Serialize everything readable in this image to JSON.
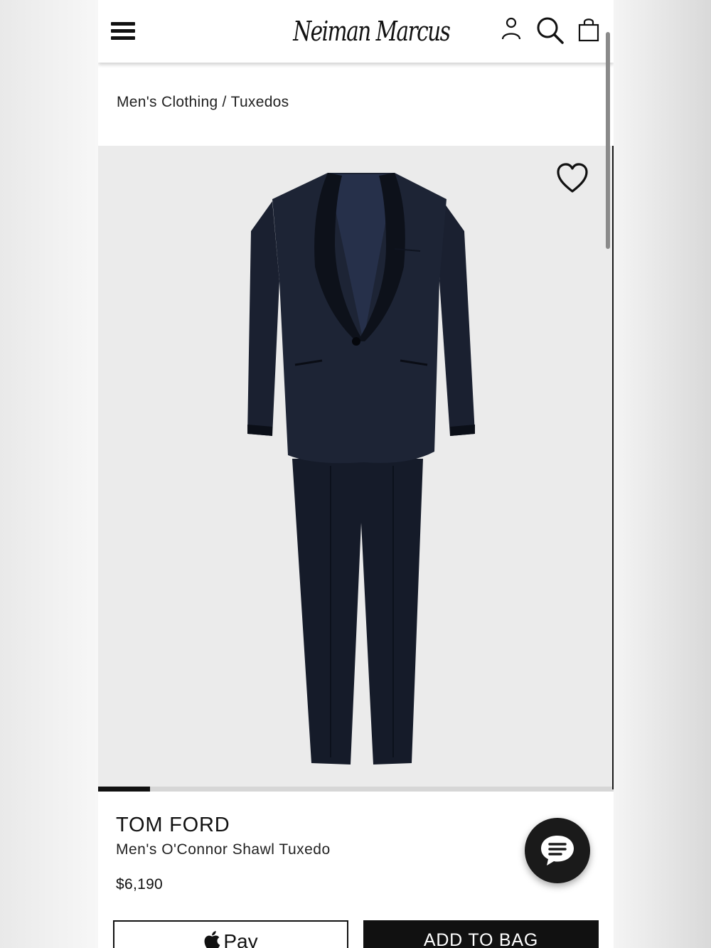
{
  "header": {
    "brand": "Neiman Marcus",
    "icons": [
      "menu-icon",
      "account-icon",
      "search-icon",
      "shopping-bag-icon"
    ]
  },
  "breadcrumb": {
    "items": [
      "Men's Clothing",
      "Tuxedos"
    ],
    "separator": "/"
  },
  "gallery": {
    "icons": [
      "heart-icon"
    ],
    "progress_fraction": 0.1
  },
  "product": {
    "designer": "TOM FORD",
    "name": "Men's O'Connor Shawl Tuxedo",
    "price": "$6,190"
  },
  "chat": {
    "icon": "chat-icon"
  },
  "actions": {
    "apple_pay_label": "Pay",
    "add_to_bag_label": "ADD TO BAG"
  },
  "colors": {
    "accent": "#111111",
    "image_background": "#ebebeb",
    "suit_navy": "#1a2030"
  }
}
